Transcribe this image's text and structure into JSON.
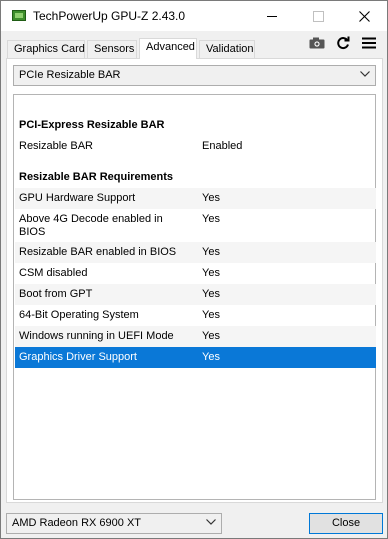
{
  "window": {
    "title": "TechPowerUp GPU-Z 2.43.0"
  },
  "tabs": [
    {
      "label": "Graphics Card"
    },
    {
      "label": "Sensors"
    },
    {
      "label": "Advanced",
      "active": true
    },
    {
      "label": "Validation"
    }
  ],
  "toolbar": {
    "icons": [
      "camera-icon",
      "refresh-icon",
      "menu-icon"
    ]
  },
  "section_select": {
    "value": "PCIe Resizable BAR"
  },
  "sections": [
    {
      "heading": "PCI-Express Resizable BAR",
      "rows": [
        {
          "label": "Resizable BAR",
          "value": "Enabled"
        }
      ]
    },
    {
      "heading": "Resizable BAR Requirements",
      "rows": [
        {
          "label": "GPU Hardware Support",
          "value": "Yes"
        },
        {
          "label": "Above 4G Decode enabled in BIOS",
          "value": "Yes"
        },
        {
          "label": "Resizable BAR enabled in BIOS",
          "value": "Yes"
        },
        {
          "label": "CSM disabled",
          "value": "Yes"
        },
        {
          "label": "Boot from GPT",
          "value": "Yes"
        },
        {
          "label": "64-Bit Operating System",
          "value": "Yes"
        },
        {
          "label": "Windows running in UEFI Mode",
          "value": "Yes"
        },
        {
          "label": "Graphics Driver Support",
          "value": "Yes",
          "selected": true
        }
      ]
    }
  ],
  "gpu_select": {
    "value": "AMD Radeon RX 6900 XT"
  },
  "close_button": {
    "label": "Close"
  },
  "colors": {
    "selection": "#0a78d7",
    "accent": "#0078d7"
  }
}
